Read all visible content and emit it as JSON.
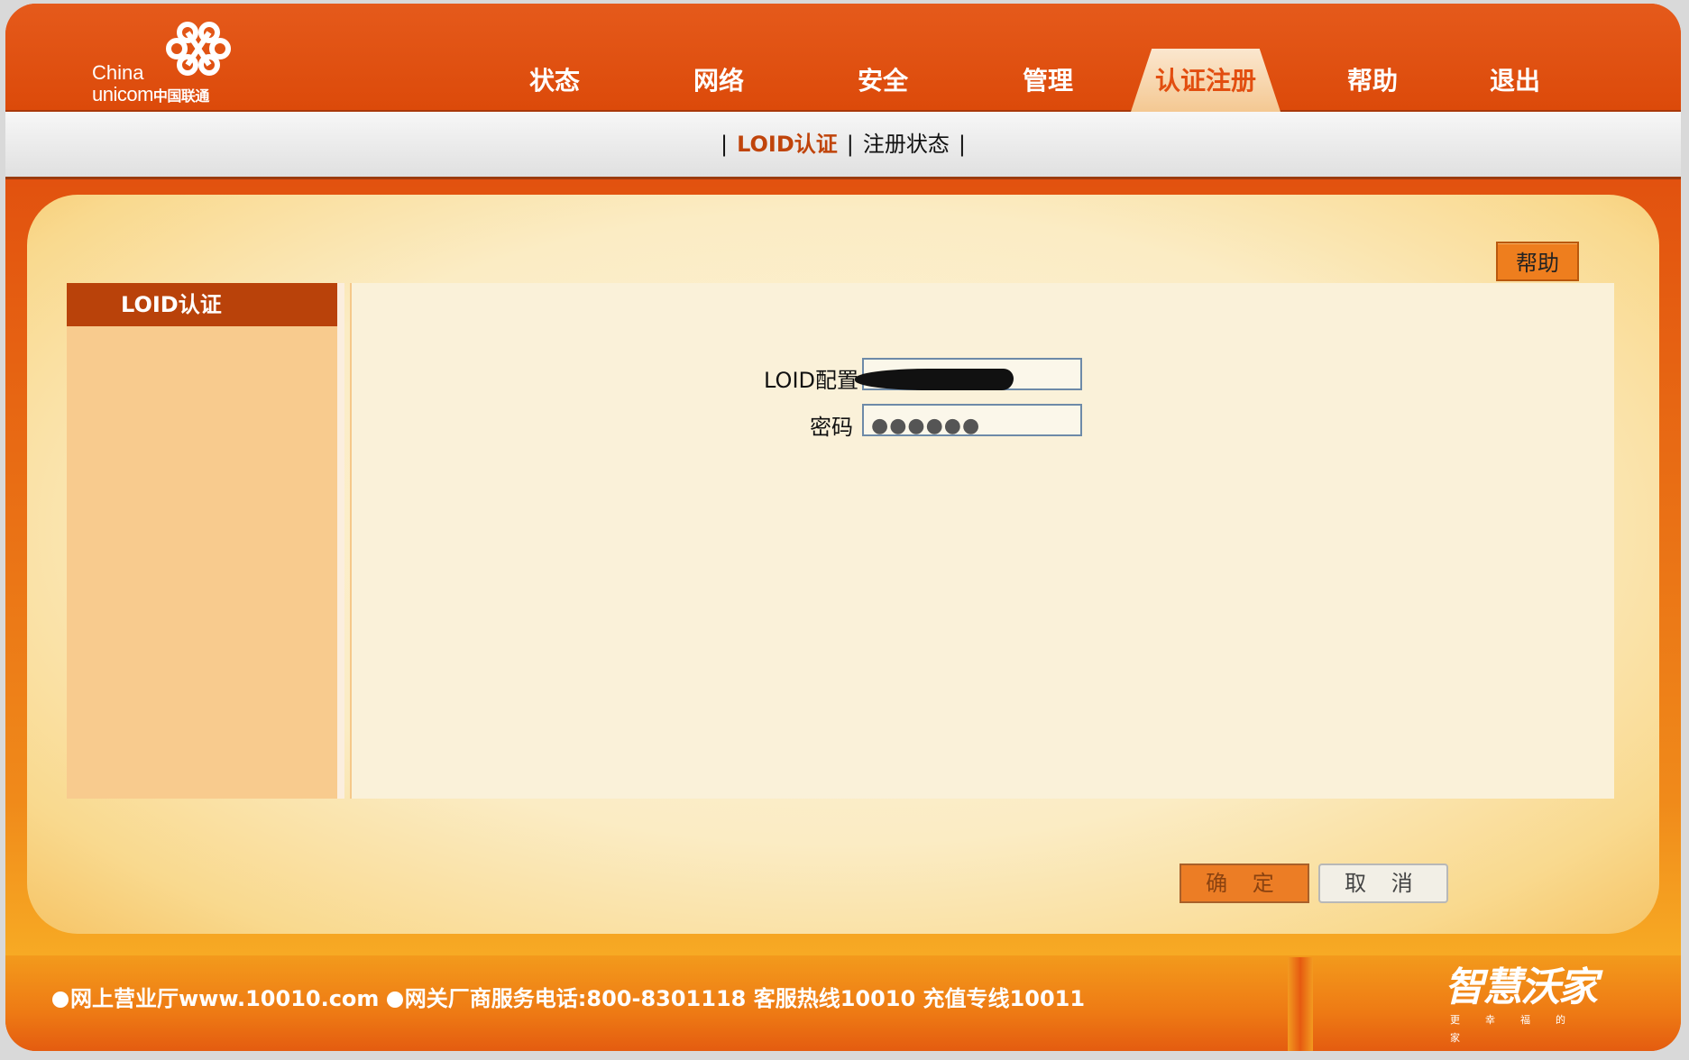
{
  "logo": {
    "line1": "China",
    "line2": "unicom",
    "line2_cn": "中国联通"
  },
  "nav": {
    "items": [
      {
        "label": "状态"
      },
      {
        "label": "网络"
      },
      {
        "label": "安全"
      },
      {
        "label": "管理"
      },
      {
        "label": "认证注册",
        "active": true
      },
      {
        "label": "帮助"
      },
      {
        "label": "退出"
      }
    ]
  },
  "subnav": {
    "sep": "|",
    "items": [
      {
        "label": "LOID认证",
        "active": true
      },
      {
        "label": "注册状态"
      }
    ]
  },
  "help_button": "帮助",
  "sidebar": {
    "title": "LOID认证"
  },
  "form": {
    "loid_label": "LOID配置",
    "password_label": "密码",
    "password_display": "●●●●●●"
  },
  "buttons": {
    "ok": "确 定",
    "cancel": "取 消"
  },
  "footer": {
    "text1": "网上营业厅www.10010.com",
    "text2": "网关厂商服务电话:800-8301118 客服热线10010 充值专线10011"
  },
  "brand": {
    "title": "智慧沃家",
    "slogan": "更幸福的家"
  },
  "colors": {
    "primary": "#e24e10",
    "sidebar": "#f8cb8e",
    "content_bg": "#faf1d9",
    "active_text": "#c0440b"
  }
}
